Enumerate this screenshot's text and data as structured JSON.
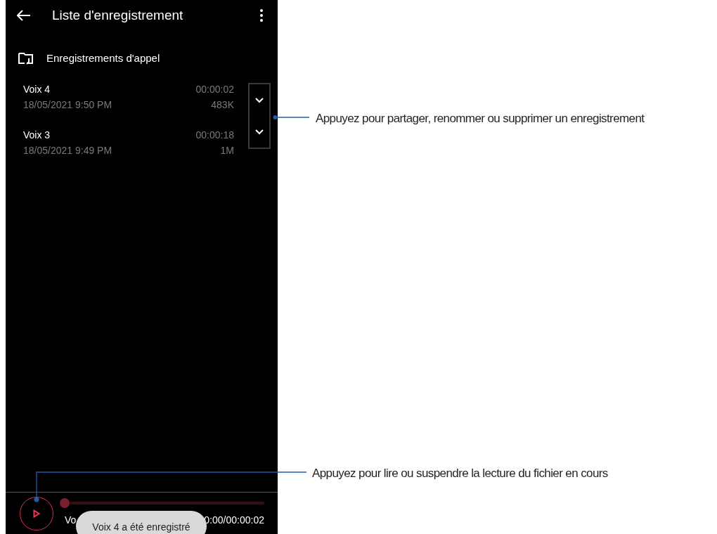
{
  "app_bar": {
    "title": "Liste d'enregistrement"
  },
  "folder": {
    "label": "Enregistrements d'appel"
  },
  "recordings": [
    {
      "name": "Voix 4",
      "date": "18/05/2021 9:50 PM",
      "duration": "00:00:02",
      "size": "483K"
    },
    {
      "name": "Voix 3",
      "date": "18/05/2021 9:49 PM",
      "duration": "00:00:18",
      "size": "1M"
    }
  ],
  "player": {
    "title": "Vo",
    "time": "0:00/00:00:02",
    "level": 0
  },
  "toast": {
    "text": "Voix 4 a été enregistré"
  },
  "callouts": [
    {
      "text": "Appuyez pour partager, renommer ou supprimer un enregistrement"
    },
    {
      "text": "Appuyez pour lire ou suspendre la lecture du fichier en cours"
    }
  ]
}
